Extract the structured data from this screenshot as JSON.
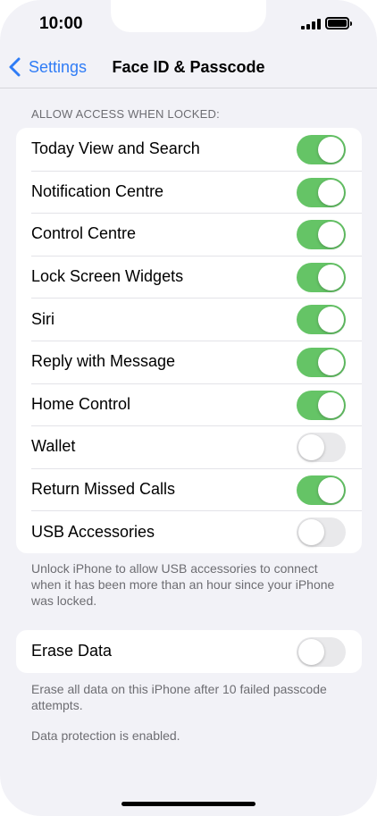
{
  "status": {
    "time": "10:00"
  },
  "nav": {
    "back_label": "Settings",
    "title": "Face ID & Passcode"
  },
  "section": {
    "header": "ALLOW ACCESS WHEN LOCKED:"
  },
  "items": [
    {
      "label": "Today View and Search",
      "on": true
    },
    {
      "label": "Notification Centre",
      "on": true
    },
    {
      "label": "Control Centre",
      "on": true
    },
    {
      "label": "Lock Screen Widgets",
      "on": true
    },
    {
      "label": "Siri",
      "on": true
    },
    {
      "label": "Reply with Message",
      "on": true
    },
    {
      "label": "Home Control",
      "on": true
    },
    {
      "label": "Wallet",
      "on": false
    },
    {
      "label": "Return Missed Calls",
      "on": true
    },
    {
      "label": "USB Accessories",
      "on": false
    }
  ],
  "usb_footer": "Unlock iPhone to allow USB accessories to connect when it has been more than an hour since your iPhone was locked.",
  "erase": {
    "label": "Erase Data",
    "on": false
  },
  "erase_footer": "Erase all data on this iPhone after 10 failed passcode attempts.",
  "protection_note": "Data protection is enabled.",
  "colors": {
    "accent": "#2f7cf6",
    "toggle_on": "#65c466",
    "toggle_off": "#e9e9eb",
    "background": "#f2f2f7"
  }
}
